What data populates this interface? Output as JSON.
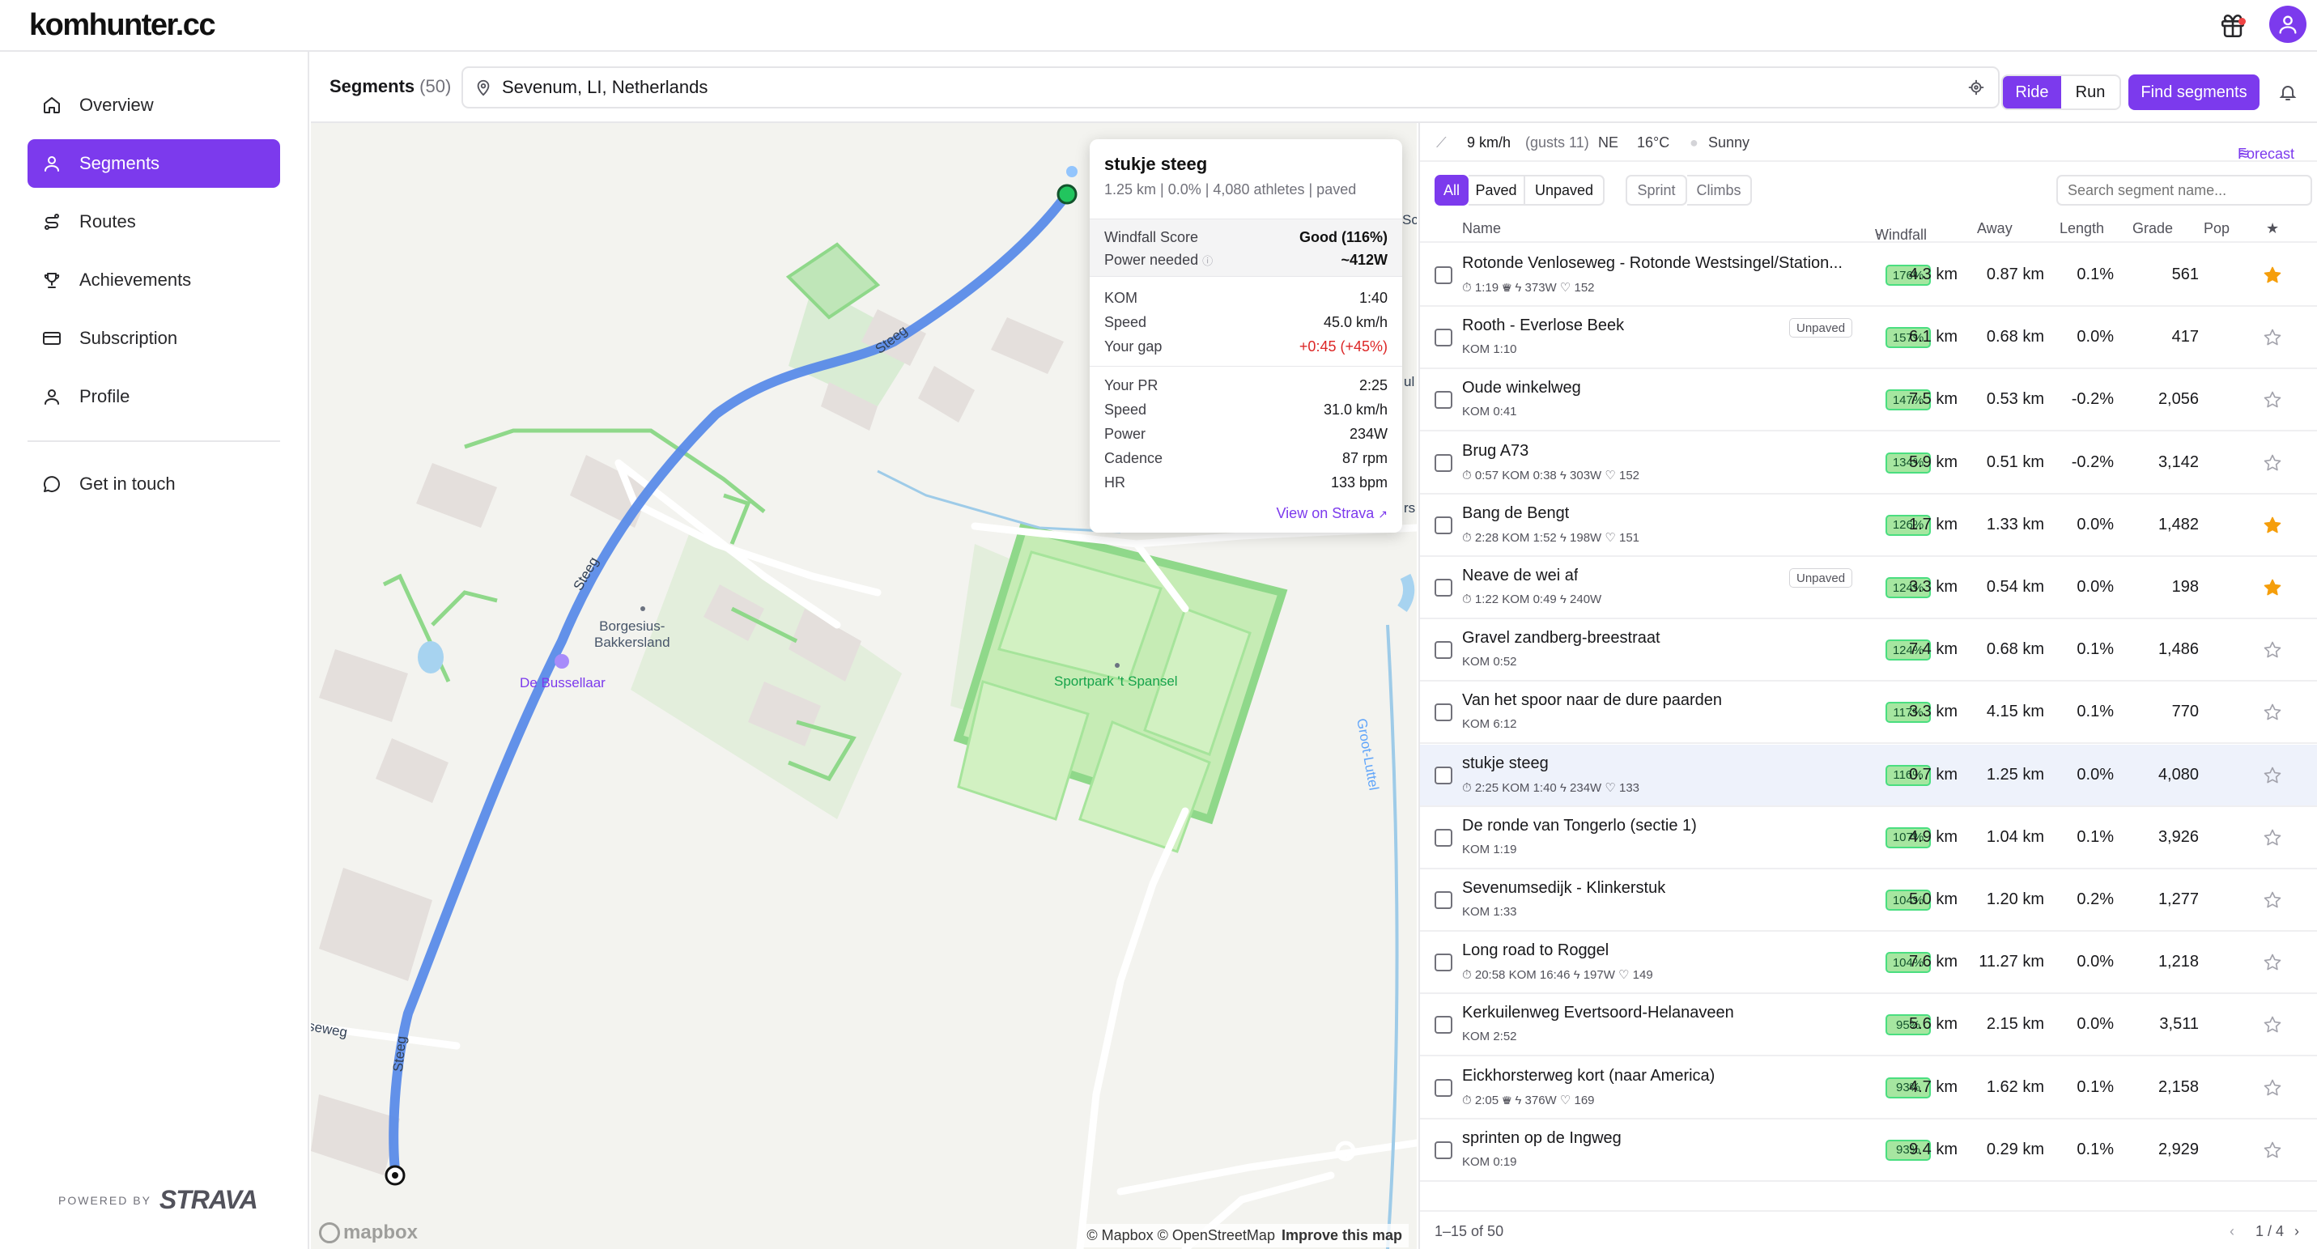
{
  "app": {
    "logo": "komhunter.cc"
  },
  "sidebar": {
    "items": [
      {
        "label": "Overview",
        "icon": "home-icon"
      },
      {
        "label": "Segments",
        "icon": "segments-icon",
        "active": true
      },
      {
        "label": "Routes",
        "icon": "routes-icon"
      },
      {
        "label": "Achievements",
        "icon": "trophy-icon"
      },
      {
        "label": "Subscription",
        "icon": "card-icon"
      },
      {
        "label": "Profile",
        "icon": "user-icon"
      }
    ],
    "contact": {
      "label": "Get in touch",
      "icon": "chat-icon"
    },
    "powered_small": "POWERED BY",
    "powered_big": "STRAVA"
  },
  "header": {
    "title": "Segments",
    "count": "(50)",
    "location": "Sevenum, LI, Netherlands",
    "sport_options": [
      "Ride",
      "Run"
    ],
    "sport_selected": "Ride",
    "find_label": "Find segments"
  },
  "map": {
    "labels": {
      "street": "Steeg",
      "place": "Borgesius-\nBakkersland",
      "poi_bussellaar": "De Bussellaar",
      "sportpark": "Sportpark 't Spansel",
      "waterway": "Groot-Luttel",
      "street_left": "seweg",
      "edge_sc": "Sc",
      "edge_ul": "ul",
      "edge_rs": "rs"
    },
    "attribution": "© Mapbox © OpenStreetMap",
    "improve": "Improve this map",
    "mapbox_logo": "mapbox"
  },
  "popup": {
    "title": "stukje steeg",
    "subtitle": "1.25 km | 0.0% | 4,080 athletes | paved",
    "windfall_label": "Windfall Score",
    "windfall_value": "Good (116%)",
    "power_label": "Power needed",
    "power_value": "~412W",
    "kom_label": "KOM",
    "kom_value": "1:40",
    "speed_label": "Speed",
    "speed_value": "45.0 km/h",
    "gap_label": "Your gap",
    "gap_value": "+0:45 (+45%)",
    "pr_label": "Your PR",
    "pr_value": "2:25",
    "pr_speed_label": "Speed",
    "pr_speed_value": "31.0 km/h",
    "pr_power_label": "Power",
    "pr_power_value": "234W",
    "cadence_label": "Cadence",
    "cadence_value": "87 rpm",
    "hr_label": "HR",
    "hr_value": "133 bpm",
    "link": "View on Strava"
  },
  "weather": {
    "wind": "9 km/h",
    "gusts": "(gusts 11)",
    "direction": "NE",
    "temp": "16°C",
    "condition": "Sunny",
    "forecast_label": "Forecast"
  },
  "filters": {
    "surface": [
      "All",
      "Paved",
      "Unpaved"
    ],
    "surface_selected": "All",
    "type": [
      "Sprint",
      "Climbs"
    ],
    "search_placeholder": "Search segment name..."
  },
  "table": {
    "columns": {
      "name": "Name",
      "windfall": "Windfall",
      "away": "Away",
      "length": "Length",
      "grade": "Grade",
      "pop": "Pop",
      "star": "★"
    },
    "rows": [
      {
        "name": "Rotonde Venloseweg - Rotonde Westsingel/Station...",
        "meta": "⏱ 1:19 ♛  ϟ 373W  ♡ 152",
        "unpaved": "",
        "windfall": "176%",
        "away": "4.3 km",
        "length": "0.87 km",
        "grade": "0.1%",
        "pop": "561",
        "starred": true
      },
      {
        "name": "Rooth - Everlose Beek",
        "meta": "KOM 1:10",
        "unpaved": "Unpaved",
        "windfall": "157%",
        "away": "6.1 km",
        "length": "0.68 km",
        "grade": "0.0%",
        "pop": "417",
        "starred": false
      },
      {
        "name": "Oude winkelweg",
        "meta": "KOM 0:41",
        "unpaved": "",
        "windfall": "147%",
        "away": "7.5 km",
        "length": "0.53 km",
        "grade": "-0.2%",
        "pop": "2,056",
        "starred": false
      },
      {
        "name": "Brug A73",
        "meta": "⏱ 0:57  KOM 0:38  ϟ 303W  ♡ 152",
        "unpaved": "",
        "windfall": "134%",
        "away": "5.9 km",
        "length": "0.51 km",
        "grade": "-0.2%",
        "pop": "3,142",
        "starred": false
      },
      {
        "name": "Bang de Bengt",
        "meta": "⏱ 2:28  KOM 1:52  ϟ 198W  ♡ 151",
        "unpaved": "",
        "windfall": "126%",
        "away": "1.7 km",
        "length": "1.33 km",
        "grade": "0.0%",
        "pop": "1,482",
        "starred": true
      },
      {
        "name": "Neave de wei af",
        "meta": "⏱ 1:22  KOM 0:49  ϟ 240W",
        "unpaved": "Unpaved",
        "windfall": "124%",
        "away": "3.3 km",
        "length": "0.54 km",
        "grade": "0.0%",
        "pop": "198",
        "starred": true
      },
      {
        "name": "Gravel zandberg-breestraat",
        "meta": "KOM 0:52",
        "unpaved": "",
        "windfall": "124%",
        "away": "7.4 km",
        "length": "0.68 km",
        "grade": "0.1%",
        "pop": "1,486",
        "starred": false
      },
      {
        "name": "Van het spoor naar de dure paarden",
        "meta": "KOM 6:12",
        "unpaved": "",
        "windfall": "117%",
        "away": "3.3 km",
        "length": "4.15 km",
        "grade": "0.1%",
        "pop": "770",
        "starred": false
      },
      {
        "name": "stukje steeg",
        "meta": "⏱ 2:25  KOM 1:40  ϟ 234W  ♡ 133",
        "unpaved": "",
        "windfall": "116%",
        "away": "0.7 km",
        "length": "1.25 km",
        "grade": "0.0%",
        "pop": "4,080",
        "starred": false,
        "highlight": true
      },
      {
        "name": "De ronde van Tongerlo (sectie 1)",
        "meta": "KOM 1:19",
        "unpaved": "",
        "windfall": "107%",
        "away": "4.9 km",
        "length": "1.04 km",
        "grade": "0.1%",
        "pop": "3,926",
        "starred": false
      },
      {
        "name": "Sevenumsedijk - Klinkerstuk",
        "meta": "KOM 1:33",
        "unpaved": "",
        "windfall": "104%",
        "away": "5.0 km",
        "length": "1.20 km",
        "grade": "0.2%",
        "pop": "1,277",
        "starred": false
      },
      {
        "name": "Long road to Roggel",
        "meta": "⏱ 20:58  KOM 16:46  ϟ 197W  ♡ 149",
        "unpaved": "",
        "windfall": "104%",
        "away": "7.6 km",
        "length": "11.27 km",
        "grade": "0.0%",
        "pop": "1,218",
        "starred": false
      },
      {
        "name": "Kerkuilenweg Evertsoord-Helanaveen",
        "meta": "KOM 2:52",
        "unpaved": "",
        "windfall": "95%",
        "away": "5.6 km",
        "length": "2.15 km",
        "grade": "0.0%",
        "pop": "3,511",
        "starred": false
      },
      {
        "name": "Eickhorsterweg kort (naar America)",
        "meta": "⏱ 2:05 ♛  ϟ 376W  ♡ 169",
        "unpaved": "",
        "windfall": "93%",
        "away": "4.7 km",
        "length": "1.62 km",
        "grade": "0.1%",
        "pop": "2,158",
        "starred": false
      },
      {
        "name": "sprinten op de Ingweg",
        "meta": "KOM 0:19",
        "unpaved": "",
        "windfall": "93%",
        "away": "9.4 km",
        "length": "0.29 km",
        "grade": "0.1%",
        "pop": "2,929",
        "starred": false
      }
    ],
    "footer_range": "1–15 of 50",
    "page": "1 / 4"
  },
  "colors": {
    "accent": "#7c3aed",
    "route": "#3b82f6",
    "star": "#f59e0b",
    "badge": "#a6e6a0"
  }
}
